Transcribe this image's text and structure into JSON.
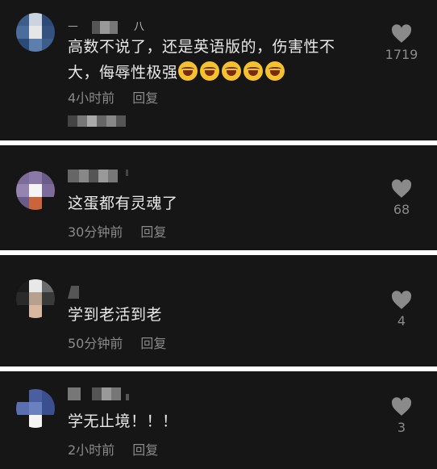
{
  "comments": [
    {
      "text": "高数不说了，还是英语版的，伤害性不大，侮辱性极强",
      "emoji_count": 5,
      "time": "4小时前",
      "reply": "回复",
      "likes": "1719",
      "name_blur_text": "ㅡ",
      "name_suffix": "八"
    },
    {
      "text": "这蛋都有灵魂了",
      "time": "30分钟前",
      "reply": "回复",
      "likes": "68"
    },
    {
      "text": "学到老活到老",
      "time": "50分钟前",
      "reply": "回复",
      "likes": "4"
    },
    {
      "text": "学无止境！！！",
      "time": "2小时前",
      "reply": "回复",
      "likes": "3"
    }
  ],
  "icons": {
    "like": "heart-icon",
    "emoji": "laughing-crying-emoji-icon"
  },
  "colors": {
    "card_bg": "#161616",
    "text": "#e8e8e8",
    "meta": "#8a8a8a"
  }
}
